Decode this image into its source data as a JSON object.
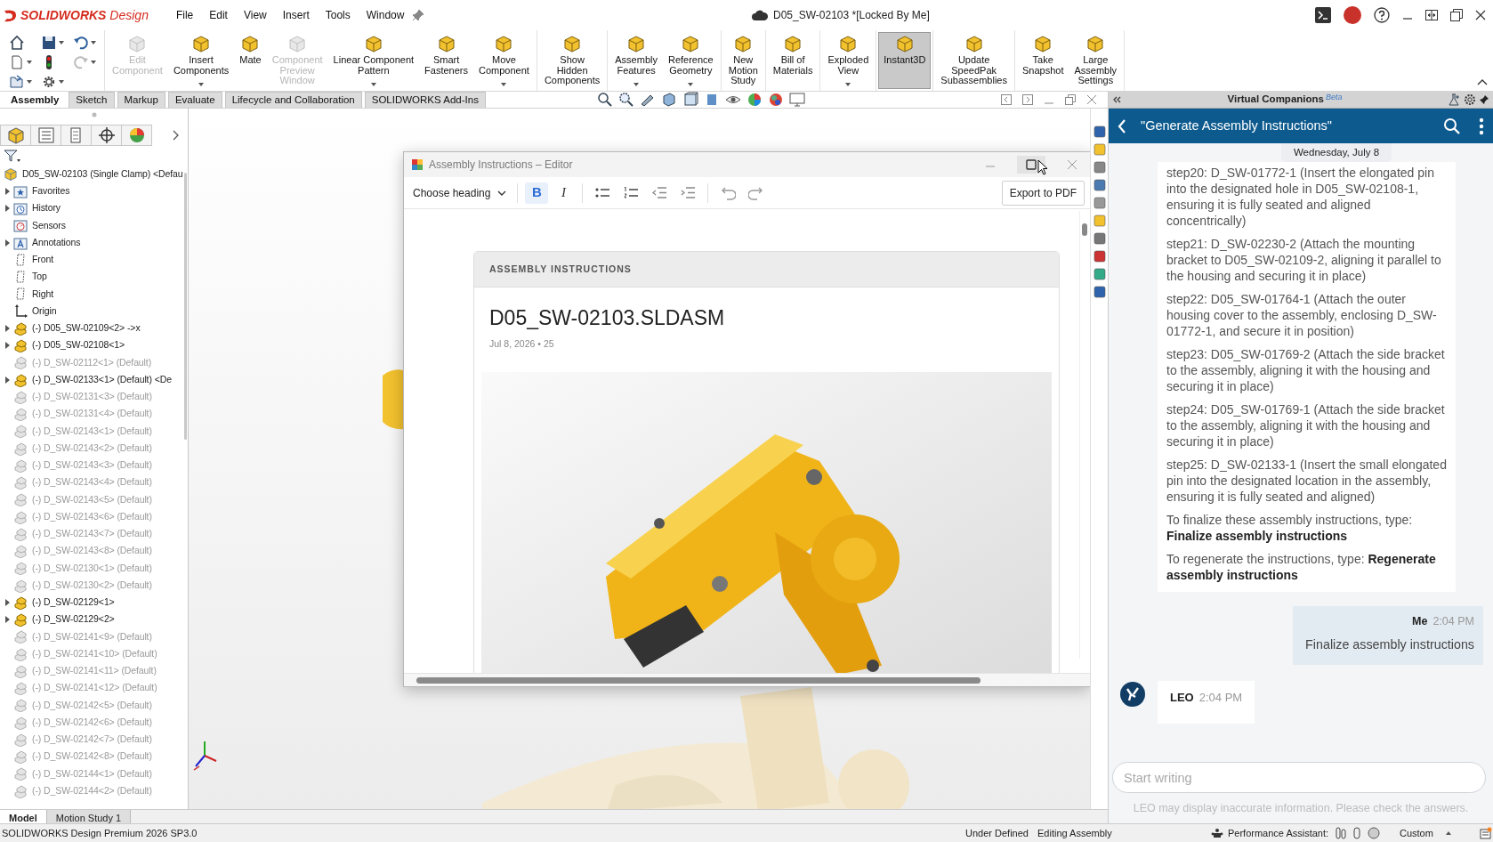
{
  "app_title": "**SOLIDWORKS** Design",
  "menu": [
    "File",
    "Edit",
    "View",
    "Insert",
    "Tools",
    "Window"
  ],
  "document_title": "D05_SW-02103 *[Locked By Me]",
  "toolbar_groups": [
    [
      {
        "label": "Edit\nComponent",
        "disabled": true,
        "dropdown": false,
        "selected": false
      },
      {
        "label": "Insert\nComponents",
        "disabled": false,
        "dropdown": true,
        "selected": false
      },
      {
        "label": "Mate",
        "disabled": false,
        "dropdown": false,
        "selected": false
      },
      {
        "label": "Component\nPreview\nWindow",
        "disabled": true,
        "dropdown": false,
        "selected": false
      },
      {
        "label": "Linear Component\nPattern",
        "disabled": false,
        "dropdown": true,
        "selected": false
      },
      {
        "label": "Smart\nFasteners",
        "disabled": false,
        "dropdown": false,
        "selected": false
      },
      {
        "label": "Move\nComponent",
        "disabled": false,
        "dropdown": true,
        "selected": false
      }
    ],
    [
      {
        "label": "Show\nHidden\nComponents",
        "disabled": false,
        "dropdown": false,
        "selected": false
      }
    ],
    [
      {
        "label": "Assembly\nFeatures",
        "disabled": false,
        "dropdown": true,
        "selected": false
      },
      {
        "label": "Reference\nGeometry",
        "disabled": false,
        "dropdown": true,
        "selected": false
      }
    ],
    [
      {
        "label": "New\nMotion\nStudy",
        "disabled": false,
        "dropdown": false,
        "selected": false
      }
    ],
    [
      {
        "label": "Bill of\nMaterials",
        "disabled": false,
        "dropdown": false,
        "selected": false
      }
    ],
    [
      {
        "label": "Exploded\nView",
        "disabled": false,
        "dropdown": true,
        "selected": false
      }
    ],
    [
      {
        "label": "Instant3D",
        "disabled": false,
        "dropdown": false,
        "selected": true
      }
    ],
    [
      {
        "label": "Update\nSpeedPak\nSubassemblies",
        "disabled": false,
        "dropdown": false,
        "selected": false
      }
    ],
    [
      {
        "label": "Take\nSnapshot",
        "disabled": false,
        "dropdown": false,
        "selected": false
      },
      {
        "label": "Large\nAssembly\nSettings",
        "disabled": false,
        "dropdown": false,
        "selected": false
      }
    ]
  ],
  "command_tabs": [
    {
      "label": "Assembly",
      "selected": true
    },
    {
      "label": "Sketch",
      "selected": false
    },
    {
      "label": "Markup",
      "selected": false
    },
    {
      "label": "Evaluate",
      "selected": false
    },
    {
      "label": "Lifecycle and Collaboration",
      "selected": false
    },
    {
      "label": "SOLIDWORKS Add-Ins",
      "selected": false
    }
  ],
  "tree": {
    "root": "D05_SW-02103 (Single Clamp) <Defau",
    "items": [
      {
        "label": "Favorites",
        "kind": "favorites",
        "expandable": true,
        "suppressed": false
      },
      {
        "label": "History",
        "kind": "history",
        "expandable": true,
        "suppressed": false
      },
      {
        "label": "Sensors",
        "kind": "sensors",
        "expandable": false,
        "suppressed": false
      },
      {
        "label": "Annotations",
        "kind": "annotations",
        "expandable": true,
        "suppressed": false
      },
      {
        "label": "Front",
        "kind": "plane",
        "expandable": false,
        "suppressed": false
      },
      {
        "label": "Top",
        "kind": "plane",
        "expandable": false,
        "suppressed": false
      },
      {
        "label": "Right",
        "kind": "plane",
        "expandable": false,
        "suppressed": false
      },
      {
        "label": "Origin",
        "kind": "origin",
        "expandable": false,
        "suppressed": false
      },
      {
        "label": "(-) D05_SW-02109<2> ->x",
        "kind": "assembly",
        "expandable": true,
        "suppressed": false
      },
      {
        "label": "(-) D05_SW-02108<1>",
        "kind": "assembly",
        "expandable": true,
        "suppressed": false
      },
      {
        "label": "(-) D_SW-02112<1> (Default)",
        "kind": "part",
        "expandable": false,
        "suppressed": true
      },
      {
        "label": "(-) D_SW-02133<1> (Default) <De",
        "kind": "assembly",
        "expandable": true,
        "suppressed": false
      },
      {
        "label": "(-) D_SW-02131<3> (Default)",
        "kind": "part",
        "expandable": false,
        "suppressed": true
      },
      {
        "label": "(-) D_SW-02131<4> (Default)",
        "kind": "part",
        "expandable": false,
        "suppressed": true
      },
      {
        "label": "(-) D_SW-02143<1> (Default)",
        "kind": "part",
        "expandable": false,
        "suppressed": true
      },
      {
        "label": "(-) D_SW-02143<2> (Default)",
        "kind": "part",
        "expandable": false,
        "suppressed": true
      },
      {
        "label": "(-) D_SW-02143<3> (Default)",
        "kind": "part",
        "expandable": false,
        "suppressed": true
      },
      {
        "label": "(-) D_SW-02143<4> (Default)",
        "kind": "part",
        "expandable": false,
        "suppressed": true
      },
      {
        "label": "(-) D_SW-02143<5> (Default)",
        "kind": "part",
        "expandable": false,
        "suppressed": true
      },
      {
        "label": "(-) D_SW-02143<6> (Default)",
        "kind": "part",
        "expandable": false,
        "suppressed": true
      },
      {
        "label": "(-) D_SW-02143<7> (Default)",
        "kind": "part",
        "expandable": false,
        "suppressed": true
      },
      {
        "label": "(-) D_SW-02143<8> (Default)",
        "kind": "part",
        "expandable": false,
        "suppressed": true
      },
      {
        "label": "(-) D_SW-02130<1> (Default)",
        "kind": "part",
        "expandable": false,
        "suppressed": true
      },
      {
        "label": "(-) D_SW-02130<2> (Default)",
        "kind": "part",
        "expandable": false,
        "suppressed": true
      },
      {
        "label": "(-) D_SW-02129<1>",
        "kind": "assembly",
        "expandable": true,
        "suppressed": false
      },
      {
        "label": "(-) D_SW-02129<2>",
        "kind": "assembly",
        "expandable": true,
        "suppressed": false
      },
      {
        "label": "(-) D_SW-02141<9> (Default)",
        "kind": "part",
        "expandable": false,
        "suppressed": true
      },
      {
        "label": "(-) D_SW-02141<10> (Default)",
        "kind": "part",
        "expandable": false,
        "suppressed": true
      },
      {
        "label": "(-) D_SW-02141<11> (Default)",
        "kind": "part",
        "expandable": false,
        "suppressed": true
      },
      {
        "label": "(-) D_SW-02141<12> (Default)",
        "kind": "part",
        "expandable": false,
        "suppressed": true
      },
      {
        "label": "(-) D_SW-02142<5> (Default)",
        "kind": "part",
        "expandable": false,
        "suppressed": true
      },
      {
        "label": "(-) D_SW-02142<6> (Default)",
        "kind": "part",
        "expandable": false,
        "suppressed": true
      },
      {
        "label": "(-) D_SW-02142<7> (Default)",
        "kind": "part",
        "expandable": false,
        "suppressed": true
      },
      {
        "label": "(-) D_SW-02142<8> (Default)",
        "kind": "part",
        "expandable": false,
        "suppressed": true
      },
      {
        "label": "(-) D_SW-02144<1> (Default)",
        "kind": "part",
        "expandable": false,
        "suppressed": true
      },
      {
        "label": "(-) D_SW-02144<2> (Default)",
        "kind": "part",
        "expandable": false,
        "suppressed": true
      }
    ]
  },
  "bottom_tabs": [
    {
      "label": "Model",
      "selected": true
    },
    {
      "label": "Motion Study 1",
      "selected": false
    }
  ],
  "editor": {
    "title": "Assembly Instructions – Editor",
    "heading_select": "Choose heading",
    "format_buttons": [
      {
        "label": "B",
        "kind": "bold",
        "selected": true
      },
      {
        "label": "I",
        "kind": "italic",
        "selected": false
      }
    ],
    "export_button": "Export to PDF",
    "card": {
      "header": "ASSEMBLY INSTRUCTIONS",
      "title": "D05_SW-02103.SLDASM",
      "meta": "Jul 8, 2026 • 25"
    }
  },
  "companion": {
    "panel_title": "Virtual Companions",
    "badge": "Beta",
    "chat_title": "\"Generate Assembly Instructions\"",
    "date_chip": "Wednesday, July 8",
    "messages": [
      {
        "kind": "bot",
        "paragraphs": [
          "step20: D_SW-01772-1 (Insert the elongated pin into the designated hole in D05_SW-02108-1, ensuring it is fully seated and aligned concentrically)",
          "step21: D_SW-02230-2 (Attach the mounting bracket to D05_SW-02109-2, aligning it parallel to the housing and securing it in place)",
          "step22: D05_SW-01764-1 (Attach the outer housing cover to the assembly, enclosing D_SW-01772-1, and secure it in position)",
          "step23: D05_SW-01769-2 (Attach the side bracket to the assembly, aligning it with the housing and securing it in place)",
          "step24: D05_SW-01769-1 (Attach the side bracket to the assembly, aligning it with the housing and securing it in place)",
          "step25: D_SW-02133-1 (Insert the small elongated pin into the designated location in the assembly, ensuring it is fully seated and aligned)",
          "To finalize these assembly instructions, type: **Finalize assembly instructions**",
          "To regenerate the instructions, type: **Regenerate assembly instructions**"
        ]
      },
      {
        "kind": "user",
        "sender": "Me",
        "time": "2:04 PM",
        "text": "Finalize assembly instructions"
      },
      {
        "kind": "bot",
        "sender": "LEO",
        "time": "2:04 PM"
      }
    ],
    "input": {
      "placeholder": "Start writing"
    },
    "disclaimer": "LEO may display inaccurate information. Please check the answers."
  },
  "status_bar": {
    "product": "SOLIDWORKS Design Premium 2026 SP3.0",
    "state": "Under Defined",
    "mode": "Editing Assembly",
    "assistant": "Performance Assistant:",
    "units": "Custom"
  }
}
